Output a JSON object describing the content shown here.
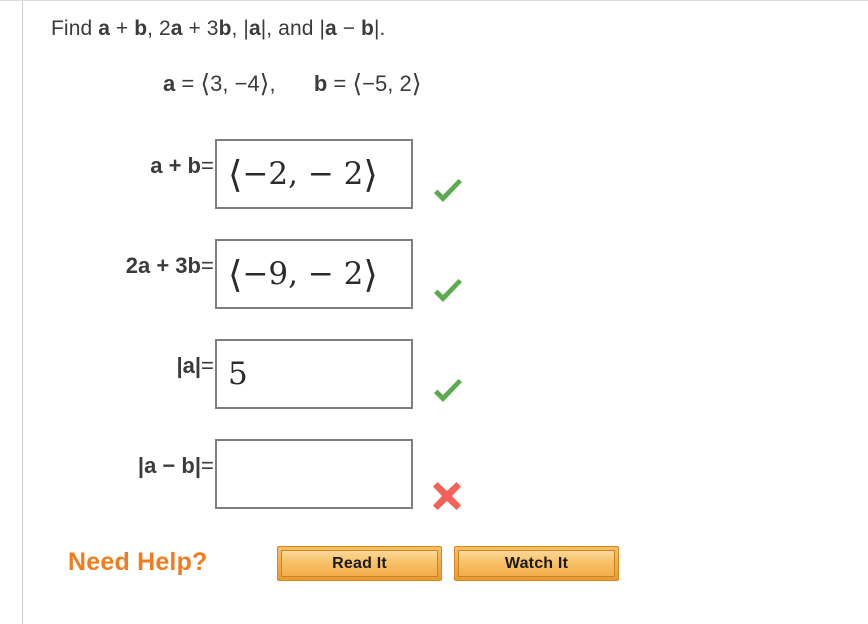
{
  "problem": {
    "prompt_prefix": "Find ",
    "prompt_terms": "a + b, 2a + 3b, |a|, and |a − b|.",
    "given_a_label": "a",
    "given_a_value": "ぐ3, −4け,",
    "given_b_label": "b",
    "given_b_value": "ぐ−5, 2け",
    "equals": "="
  },
  "rows": [
    {
      "label": "a + b",
      "equals": "=",
      "value": "ぐ−2, − 2け",
      "status": "correct",
      "status_icon": "green-check-icon"
    },
    {
      "label": "2a + 3b",
      "equals": "=",
      "value": "ぐ−9, − 2け",
      "status": "correct",
      "status_icon": "green-check-icon"
    },
    {
      "label": "|a|",
      "equals": "=",
      "value": "5",
      "status": "correct",
      "status_icon": "green-check-icon"
    },
    {
      "label": "|a − b|",
      "equals": "=",
      "value": "",
      "status": "incorrect",
      "status_icon": "red-x-icon"
    }
  ],
  "help": {
    "title": "Need Help?",
    "read_button": "Read It",
    "watch_button": "Watch It"
  },
  "colors": {
    "correct": "#5aab4e",
    "incorrect": "#f4605a",
    "help_orange": "#f07c1e",
    "button_border": "#d98520",
    "box_border": "#7d7d7d",
    "text": "#3b3b3b"
  }
}
